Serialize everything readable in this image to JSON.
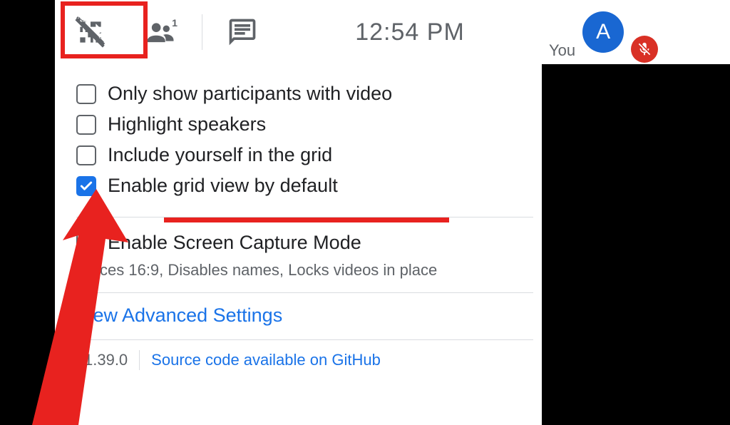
{
  "toolbar": {
    "clock": "12:54 PM"
  },
  "user": {
    "label": "You",
    "initial": "A"
  },
  "options": {
    "only_video": {
      "label": "Only show participants with video",
      "checked": false
    },
    "highlight_speakers": {
      "label": "Highlight speakers",
      "checked": false
    },
    "include_self": {
      "label": "Include yourself in the grid",
      "checked": false
    },
    "enable_grid": {
      "label": "Enable grid view by default",
      "checked": true
    },
    "screen_capture": {
      "label": "Enable Screen Capture Mode",
      "sub": "Forces 16:9, Disables names, Locks videos in place",
      "checked": false
    }
  },
  "advanced": {
    "link": "View Advanced Settings"
  },
  "footer": {
    "version": "v1.39.0",
    "source_link": "Source code available on GitHub"
  }
}
